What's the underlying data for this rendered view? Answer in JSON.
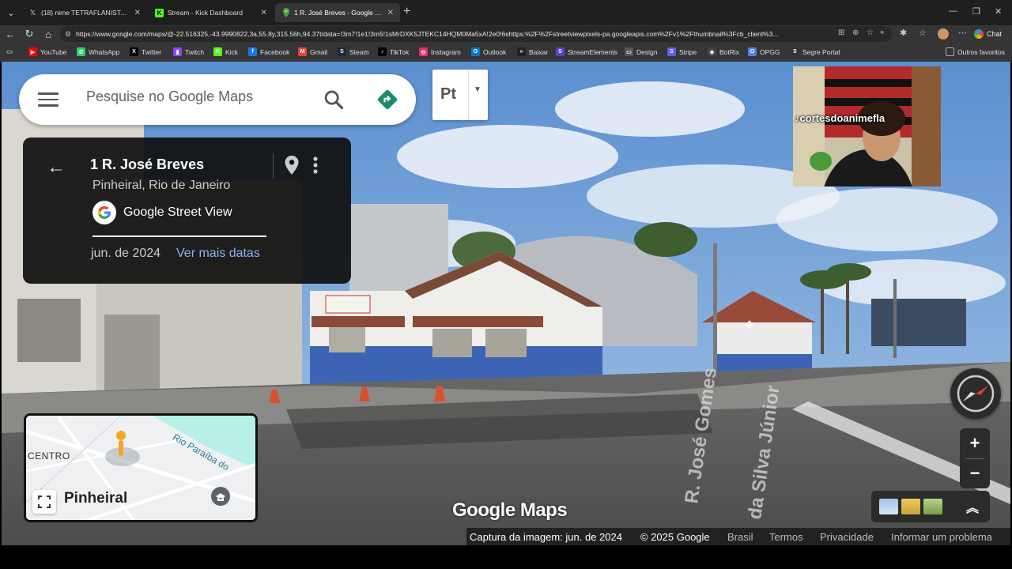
{
  "tabs": [
    {
      "title": "(18) nime TETRAFLANISTA ᴀᴏᴋᴋ (@",
      "favicon": "x-icon",
      "active": false
    },
    {
      "title": "Stream - Kick Dashboard",
      "favicon": "kick-icon",
      "active": false
    },
    {
      "title": "1 R. José Breves - Google Maps",
      "favicon": "maps-icon",
      "active": true
    }
  ],
  "address_bar": {
    "url": "https://www.google.com/maps/@-22.516325,-43.9990822,3a,55.8y,315.56h,94.37t/data=!3m7!1e1!3m5!1sMrDXK5JTEKC14HQM0Ma5xA!2e0!6shttps:%2F%2Fstreetviewpixels-pa.googleapis.com%2Fv1%2Fthumbnail%3Fcb_client%3..."
  },
  "toolbar": {
    "chat_label": "Chat"
  },
  "bookmarks": [
    {
      "label": "YouTube",
      "color": "#ff0000",
      "glyph": "▶"
    },
    {
      "label": "WhatsApp",
      "color": "#25d366",
      "glyph": "✆"
    },
    {
      "label": "Twitter",
      "color": "#000000",
      "glyph": "X"
    },
    {
      "label": "Twitch",
      "color": "#9146ff",
      "glyph": "▮"
    },
    {
      "label": "Kick",
      "color": "#53fc18",
      "glyph": "K"
    },
    {
      "label": "Facebook",
      "color": "#1877f2",
      "glyph": "f"
    },
    {
      "label": "Gmail",
      "color": "#ea4335",
      "glyph": "M"
    },
    {
      "label": "Steam",
      "color": "#1b2838",
      "glyph": "S"
    },
    {
      "label": "TikTok",
      "color": "#000000",
      "glyph": "♪"
    },
    {
      "label": "Instagram",
      "color": "#e1306c",
      "glyph": "◎"
    },
    {
      "label": "Outlook",
      "color": "#0078d4",
      "glyph": "O"
    },
    {
      "label": "Baixar",
      "color": "#222222",
      "glyph": "»"
    },
    {
      "label": "StreamElements",
      "color": "#5a3fd8",
      "glyph": "S"
    },
    {
      "label": "Design",
      "color": "#555555",
      "glyph": "▭"
    },
    {
      "label": "Stripe",
      "color": "#635bff",
      "glyph": "S"
    },
    {
      "label": "BotRix",
      "color": "#444444",
      "glyph": "◆"
    },
    {
      "label": "OPGG",
      "color": "#5383e8",
      "glyph": "O"
    },
    {
      "label": "Segre Portal",
      "color": "#333333",
      "glyph": "S"
    }
  ],
  "bookmarks_other": "Outros favoritos",
  "search": {
    "placeholder": "Pesquise no Google Maps"
  },
  "lang_button": {
    "label": "Pt"
  },
  "info_card": {
    "title": "1 R. José Breves",
    "subtitle": "Pinheiral, Rio de Janeiro",
    "source": "Google Street View",
    "date": "jun. de 2024",
    "more_dates": "Ver mais datas"
  },
  "overlay": {
    "tiktok_handle": "cortesdoanimefla"
  },
  "minimap": {
    "label_centro": "CENTRO",
    "label_place": "Pinheiral",
    "label_river": "Rio Paraíba do"
  },
  "street_labels": [
    "R. José Gomes",
    "da Silva Júnior"
  ],
  "logo_text": "Google Maps",
  "footer": {
    "capture": "Captura da imagem: jun. de 2024",
    "copyright": "© 2025 Google",
    "country": "Brasil",
    "terms": "Termos",
    "privacy": "Privacidade",
    "report": "Informar um problema"
  },
  "colors": {
    "accent_green": "#1a8c68",
    "link_blue": "#8ab4f8"
  }
}
